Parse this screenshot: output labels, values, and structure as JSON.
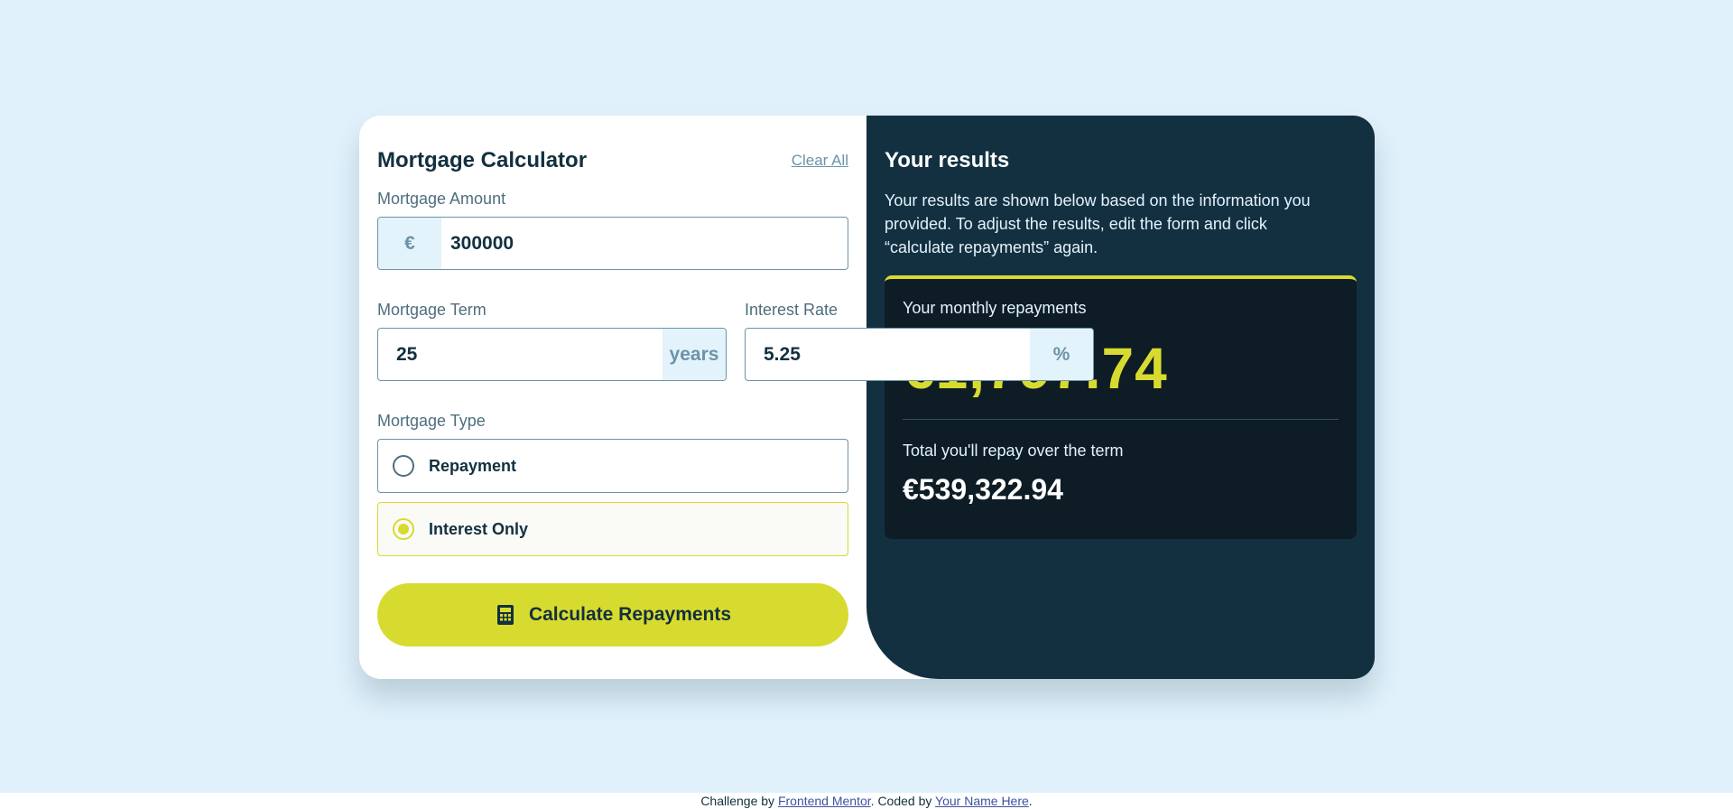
{
  "calculator": {
    "title": "Mortgage Calculator",
    "clear_label": "Clear All",
    "amount": {
      "label": "Mortgage Amount",
      "currency": "€",
      "value": "300000"
    },
    "term": {
      "label": "Mortgage Term",
      "value": "25",
      "unit": "years"
    },
    "rate": {
      "label": "Interest Rate",
      "value": "5.25",
      "unit": "%"
    },
    "type": {
      "label": "Mortgage Type",
      "options": [
        {
          "label": "Repayment",
          "selected": false
        },
        {
          "label": "Interest Only",
          "selected": true
        }
      ]
    },
    "submit_label": "Calculate Repayments"
  },
  "results": {
    "title": "Your results",
    "description": "Your results are shown below based on the information you provided. To adjust the results, edit the form and click “calculate repayments” again.",
    "monthly_label": "Your monthly repayments",
    "monthly_value": "€1,797.74",
    "total_label": "Total you'll repay over the term",
    "total_value": "€539,322.94"
  },
  "footer": {
    "prefix": "Challenge by ",
    "link1": "Frontend Mentor",
    "middle": ". Coded by ",
    "link2": "Your Name Here",
    "suffix": "."
  },
  "colors": {
    "background": "#e0f1fb",
    "accent": "#d8db2f",
    "dark": "#133041",
    "panel": "#0e1c25"
  },
  "icons": {
    "submit": "calculator-icon"
  }
}
